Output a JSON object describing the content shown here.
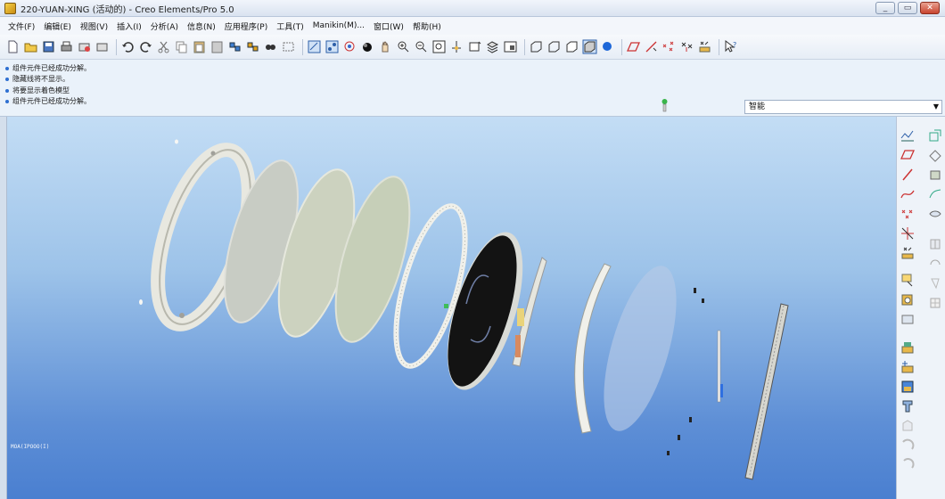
{
  "window": {
    "title": "220-YUAN-XING (活动的) - Creo Elements/Pro 5.0",
    "controls": [
      "_",
      "▭",
      "✕"
    ]
  },
  "menu": [
    "文件(F)",
    "编辑(E)",
    "视图(V)",
    "插入(I)",
    "分析(A)",
    "信息(N)",
    "应用程序(P)",
    "工具(T)",
    "Manikin(M)...",
    "窗口(W)",
    "帮助(H)"
  ],
  "messages": [
    "组件元件已经成功分解。",
    "隐藏线将不显示。",
    "将要显示着色模型",
    "组件元件已经成功分解。"
  ],
  "filter": {
    "value": "智能",
    "arrow": "▼"
  },
  "viewport": {
    "status_text": "MOA(IPOOO(I)"
  },
  "colors": {
    "accent": "#2d6fd1",
    "background_top": "#c3ddf5",
    "background_bottom": "#4a7fd0"
  }
}
